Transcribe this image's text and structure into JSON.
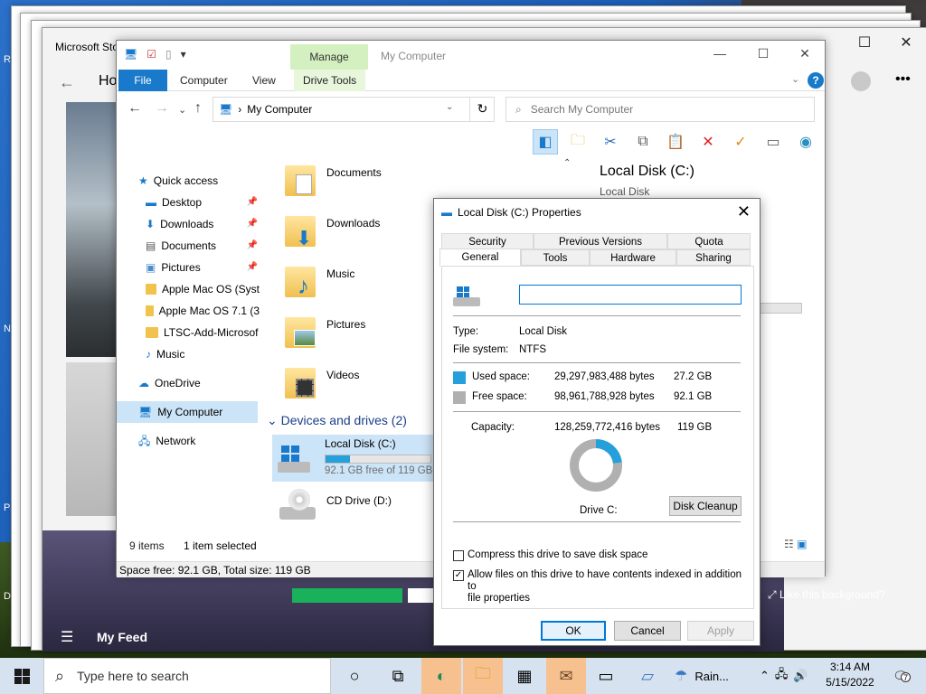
{
  "store": {
    "title": "Microsoft Sto",
    "home_label": "Ho",
    "feed_label": "My Feed",
    "like_bg": "Like this background?"
  },
  "explorer": {
    "title": "My Computer",
    "manage_tab": "Manage",
    "ribbon_tabs": [
      "File",
      "Computer",
      "View",
      "Drive Tools"
    ],
    "address": "My Computer",
    "search_placeholder": "Search My Computer",
    "nav": {
      "quick_access": "Quick access",
      "items": [
        "Desktop",
        "Downloads",
        "Documents",
        "Pictures",
        "Apple Mac OS (Syst",
        "Apple Mac OS 7.1 (3",
        "LTSC-Add-Microsof",
        "Music"
      ],
      "onedrive": "OneDrive",
      "my_computer": "My Computer",
      "network": "Network"
    },
    "folders": [
      "Documents",
      "Downloads",
      "Music",
      "Pictures",
      "Videos"
    ],
    "devices_header": "Devices and drives (2)",
    "drive_c": {
      "name": "Local Disk (C:)",
      "free": "92.1 GB free of 119 GB",
      "used_fraction": 0.23
    },
    "drive_d": {
      "name": "CD Drive (D:)"
    },
    "item_count": "9 items",
    "selected": "1 item selected",
    "status": "Space free: 92.1 GB, Total size: 119 GB",
    "preview": {
      "title": "Local Disk (C:)",
      "subtitle": "Local Disk"
    }
  },
  "props": {
    "title": "Local Disk (C:) Properties",
    "tabs_row1": [
      "Security",
      "Previous Versions",
      "Quota"
    ],
    "tabs_row2": [
      "General",
      "Tools",
      "Hardware",
      "Sharing"
    ],
    "type_label": "Type:",
    "type_value": "Local Disk",
    "fs_label": "File system:",
    "fs_value": "NTFS",
    "used_label": "Used space:",
    "used_bytes": "29,297,983,488 bytes",
    "used_gb": "27.2 GB",
    "free_label": "Free space:",
    "free_bytes": "98,961,788,928 bytes",
    "free_gb": "92.1 GB",
    "cap_label": "Capacity:",
    "cap_bytes": "128,259,772,416 bytes",
    "cap_gb": "119 GB",
    "drive_label": "Drive C:",
    "cleanup": "Disk Cleanup",
    "compress": "Compress this drive to save disk space",
    "index_line1": "Allow files on this drive to have contents indexed in addition to",
    "index_line2": "file properties",
    "ok": "OK",
    "cancel": "Cancel",
    "apply": "Apply",
    "colors": {
      "used": "#26a0da",
      "free": "#b0b0b0"
    }
  },
  "taskbar": {
    "search_placeholder": "Type here to search",
    "rain_label": "Rain...",
    "time": "3:14 AM",
    "date": "5/15/2022",
    "notif_count": "7"
  }
}
